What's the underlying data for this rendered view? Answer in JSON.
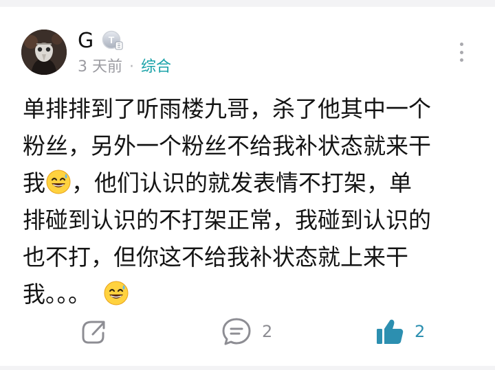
{
  "post": {
    "author": "G",
    "time": "3 天前",
    "separator": "·",
    "category": "综合",
    "lines": [
      "单排排到了听雨楼九哥，杀了他其中一个",
      "粉丝，另外一个粉丝不给我补状态就来干",
      [
        "我",
        "，他们认识的就发表情不打架，单"
      ],
      "排碰到认识的不打架正常，我碰到认识的",
      "也不打，但你这不给我补状态就上来干",
      [
        "我。。。",
        ""
      ]
    ]
  },
  "actions": {
    "comment_count": "2",
    "like_count": "2"
  },
  "icons": {
    "share": "share-icon",
    "comment": "comment-icon",
    "like": "thumbs-up-icon",
    "more": "more-vertical-icon",
    "badge": "user-level-badge-icon",
    "emoji": "grinning-sweat-emoji"
  },
  "colors": {
    "accent": "#19a2a8",
    "like_active": "#2c8fb0",
    "muted": "#9b9ba1"
  }
}
